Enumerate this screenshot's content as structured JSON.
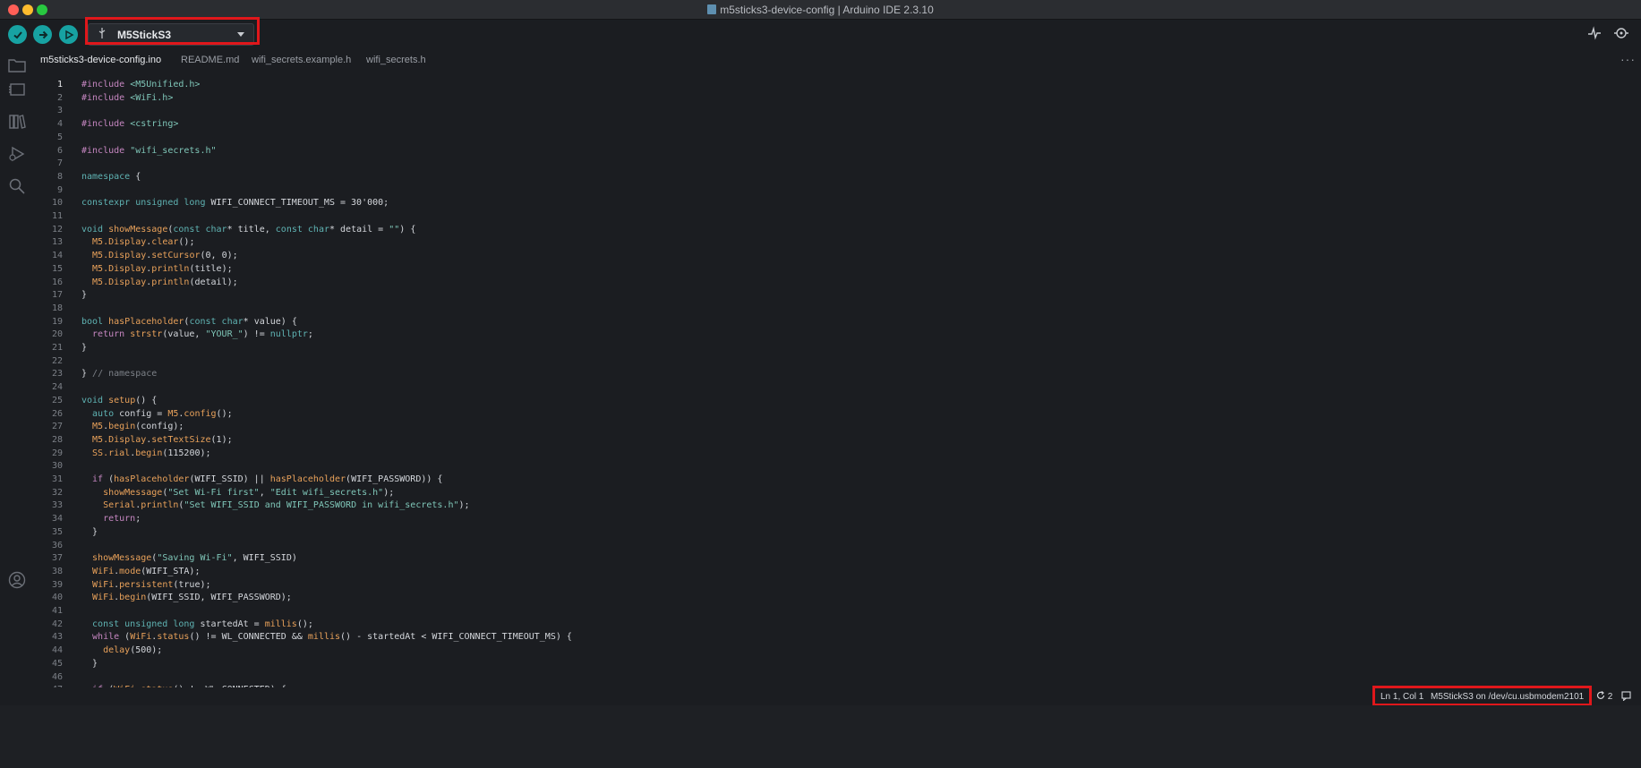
{
  "window": {
    "title": "m5sticks3-device-config | Arduino IDE 2.3.10"
  },
  "toolbar": {
    "verify_icon": "check-icon",
    "upload_icon": "arrow-right-icon",
    "debug_icon": "debug-icon",
    "board_name": "M5StickS3",
    "serial_plotter_icon": "plotter-icon",
    "serial_monitor_icon": "monitor-icon"
  },
  "sidebar": {
    "items": [
      {
        "icon": "folder-icon"
      },
      {
        "icon": "board-manager-icon"
      },
      {
        "icon": "library-icon"
      },
      {
        "icon": "debug-run-icon"
      },
      {
        "icon": "search-icon"
      },
      {
        "icon": "account-icon"
      }
    ]
  },
  "tabs": [
    {
      "label": "m5sticks3-device-config.ino"
    },
    {
      "label": "README.md"
    },
    {
      "label": "wifi_secrets.example.h"
    },
    {
      "label": "wifi_secrets.h"
    }
  ],
  "tabs_more": "···",
  "code_lines": [
    [
      {
        "t": "#include ",
        "c": "#c586c0"
      },
      {
        "t": "<M5Unified.h>",
        "c": "#7fc6b8"
      }
    ],
    [
      {
        "t": "#include ",
        "c": "#c586c0"
      },
      {
        "t": "<WiFi.h>",
        "c": "#7fc6b8"
      }
    ],
    [],
    [
      {
        "t": "#include ",
        "c": "#c586c0"
      },
      {
        "t": "<cstring>",
        "c": "#7fc6b8"
      }
    ],
    [],
    [
      {
        "t": "#include ",
        "c": "#c586c0"
      },
      {
        "t": "\"wifi_secrets.h\"",
        "c": "#7fc6b8"
      }
    ],
    [],
    [
      {
        "t": "namespace",
        "c": "#5fb3b3"
      },
      {
        "t": " {",
        "c": "#d4d7dc"
      }
    ],
    [],
    [
      {
        "t": "constexpr unsigned long ",
        "c": "#5fb3b3"
      },
      {
        "t": "WIFI_CONNECT_TIMEOUT_MS = 30'000;",
        "c": "#d4d7dc"
      }
    ],
    [],
    [
      {
        "t": "void ",
        "c": "#5fb3b3"
      },
      {
        "t": "showMessage",
        "c": "#e8a15a"
      },
      {
        "t": "(",
        "c": "#d4d7dc"
      },
      {
        "t": "const char",
        "c": "#5fb3b3"
      },
      {
        "t": "* title, ",
        "c": "#d4d7dc"
      },
      {
        "t": "const char",
        "c": "#5fb3b3"
      },
      {
        "t": "* detail = ",
        "c": "#d4d7dc"
      },
      {
        "t": "\"\"",
        "c": "#7fc6b8"
      },
      {
        "t": ") {",
        "c": "#d4d7dc"
      }
    ],
    [
      {
        "t": "  M5.",
        "c": "#e8a15a"
      },
      {
        "t": "Display",
        "c": "#e8a15a"
      },
      {
        "t": ".",
        "c": "#d4d7dc"
      },
      {
        "t": "clear",
        "c": "#e8a15a"
      },
      {
        "t": "();",
        "c": "#d4d7dc"
      }
    ],
    [
      {
        "t": "  M5.",
        "c": "#e8a15a"
      },
      {
        "t": "Display",
        "c": "#e8a15a"
      },
      {
        "t": ".",
        "c": "#d4d7dc"
      },
      {
        "t": "setCursor",
        "c": "#e8a15a"
      },
      {
        "t": "(0, 0);",
        "c": "#d4d7dc"
      }
    ],
    [
      {
        "t": "  M5.",
        "c": "#e8a15a"
      },
      {
        "t": "Display",
        "c": "#e8a15a"
      },
      {
        "t": ".",
        "c": "#d4d7dc"
      },
      {
        "t": "println",
        "c": "#e8a15a"
      },
      {
        "t": "(title);",
        "c": "#d4d7dc"
      }
    ],
    [
      {
        "t": "  M5.",
        "c": "#e8a15a"
      },
      {
        "t": "Display",
        "c": "#e8a15a"
      },
      {
        "t": ".",
        "c": "#d4d7dc"
      },
      {
        "t": "println",
        "c": "#e8a15a"
      },
      {
        "t": "(detail);",
        "c": "#d4d7dc"
      }
    ],
    [
      {
        "t": "}",
        "c": "#d4d7dc"
      }
    ],
    [],
    [
      {
        "t": "bool ",
        "c": "#5fb3b3"
      },
      {
        "t": "hasPlaceholder",
        "c": "#e8a15a"
      },
      {
        "t": "(",
        "c": "#d4d7dc"
      },
      {
        "t": "const char",
        "c": "#5fb3b3"
      },
      {
        "t": "* value) {",
        "c": "#d4d7dc"
      }
    ],
    [
      {
        "t": "  return ",
        "c": "#c586c0"
      },
      {
        "t": "strstr",
        "c": "#e8a15a"
      },
      {
        "t": "(value, ",
        "c": "#d4d7dc"
      },
      {
        "t": "\"YOUR_\"",
        "c": "#7fc6b8"
      },
      {
        "t": ") != ",
        "c": "#d4d7dc"
      },
      {
        "t": "nullptr",
        "c": "#5fb3b3"
      },
      {
        "t": ";",
        "c": "#d4d7dc"
      }
    ],
    [
      {
        "t": "}",
        "c": "#d4d7dc"
      }
    ],
    [],
    [
      {
        "t": "} ",
        "c": "#d4d7dc"
      },
      {
        "t": "// namespace",
        "c": "#7c8087"
      }
    ],
    [],
    [
      {
        "t": "void ",
        "c": "#5fb3b3"
      },
      {
        "t": "setup",
        "c": "#e8a15a"
      },
      {
        "t": "() {",
        "c": "#d4d7dc"
      }
    ],
    [
      {
        "t": "  auto ",
        "c": "#5fb3b3"
      },
      {
        "t": "config = ",
        "c": "#d4d7dc"
      },
      {
        "t": "M5",
        "c": "#e8a15a"
      },
      {
        "t": ".",
        "c": "#d4d7dc"
      },
      {
        "t": "config",
        "c": "#e8a15a"
      },
      {
        "t": "();",
        "c": "#d4d7dc"
      }
    ],
    [
      {
        "t": "  M5",
        "c": "#e8a15a"
      },
      {
        "t": ".",
        "c": "#d4d7dc"
      },
      {
        "t": "begin",
        "c": "#e8a15a"
      },
      {
        "t": "(config);",
        "c": "#d4d7dc"
      }
    ],
    [
      {
        "t": "  M5.",
        "c": "#e8a15a"
      },
      {
        "t": "Display",
        "c": "#e8a15a"
      },
      {
        "t": ".",
        "c": "#d4d7dc"
      },
      {
        "t": "setTextSize",
        "c": "#e8a15a"
      },
      {
        "t": "(1);",
        "c": "#d4d7dc"
      }
    ],
    [
      {
        "t": "  SS.",
        "c": "#e8a15a"
      },
      {
        "t": "rial",
        "c": "#e8a15a"
      },
      {
        "t": ".",
        "c": "#d4d7dc"
      },
      {
        "t": "begin",
        "c": "#e8a15a"
      },
      {
        "t": "(115200);",
        "c": "#d4d7dc"
      }
    ],
    [],
    [
      {
        "t": "  if ",
        "c": "#c586c0"
      },
      {
        "t": "(",
        "c": "#d4d7dc"
      },
      {
        "t": "hasPlaceholder",
        "c": "#e8a15a"
      },
      {
        "t": "(WIFI_SSID) || ",
        "c": "#d4d7dc"
      },
      {
        "t": "hasPlaceholder",
        "c": "#e8a15a"
      },
      {
        "t": "(WIFI_PASSWORD)) {",
        "c": "#d4d7dc"
      }
    ],
    [
      {
        "t": "    showMessage",
        "c": "#e8a15a"
      },
      {
        "t": "(",
        "c": "#d4d7dc"
      },
      {
        "t": "\"Set Wi-Fi first\"",
        "c": "#7fc6b8"
      },
      {
        "t": ", ",
        "c": "#d4d7dc"
      },
      {
        "t": "\"Edit wifi_secrets.h\"",
        "c": "#7fc6b8"
      },
      {
        "t": ");",
        "c": "#d4d7dc"
      }
    ],
    [
      {
        "t": "    Serial",
        "c": "#e8a15a"
      },
      {
        "t": ".",
        "c": "#d4d7dc"
      },
      {
        "t": "println",
        "c": "#e8a15a"
      },
      {
        "t": "(",
        "c": "#d4d7dc"
      },
      {
        "t": "\"Set WIFI_SSID and WIFI_PASSWORD in wifi_secrets.h\"",
        "c": "#7fc6b8"
      },
      {
        "t": ");",
        "c": "#d4d7dc"
      }
    ],
    [
      {
        "t": "    return",
        "c": "#c586c0"
      },
      {
        "t": ";",
        "c": "#d4d7dc"
      }
    ],
    [
      {
        "t": "  }",
        "c": "#d4d7dc"
      }
    ],
    [],
    [
      {
        "t": "  showMessage",
        "c": "#e8a15a"
      },
      {
        "t": "(",
        "c": "#d4d7dc"
      },
      {
        "t": "\"Saving Wi-Fi\"",
        "c": "#7fc6b8"
      },
      {
        "t": ", WIFI_SSID)",
        "c": "#d4d7dc"
      }
    ],
    [
      {
        "t": "  WiFi",
        "c": "#e8a15a"
      },
      {
        "t": ".",
        "c": "#d4d7dc"
      },
      {
        "t": "mode",
        "c": "#e8a15a"
      },
      {
        "t": "(WIFI_STA);",
        "c": "#d4d7dc"
      }
    ],
    [
      {
        "t": "  WiFi",
        "c": "#e8a15a"
      },
      {
        "t": ".",
        "c": "#d4d7dc"
      },
      {
        "t": "persistent",
        "c": "#e8a15a"
      },
      {
        "t": "(true);",
        "c": "#d4d7dc"
      }
    ],
    [
      {
        "t": "  WiFi",
        "c": "#e8a15a"
      },
      {
        "t": ".",
        "c": "#d4d7dc"
      },
      {
        "t": "begin",
        "c": "#e8a15a"
      },
      {
        "t": "(WIFI_SSID, WIFI_PASSWORD);",
        "c": "#d4d7dc"
      }
    ],
    [],
    [
      {
        "t": "  const unsigned long ",
        "c": "#5fb3b3"
      },
      {
        "t": "startedAt = ",
        "c": "#d4d7dc"
      },
      {
        "t": "millis",
        "c": "#e8a15a"
      },
      {
        "t": "();",
        "c": "#d4d7dc"
      }
    ],
    [
      {
        "t": "  while ",
        "c": "#c586c0"
      },
      {
        "t": "(",
        "c": "#d4d7dc"
      },
      {
        "t": "WiFi",
        "c": "#e8a15a"
      },
      {
        "t": ".",
        "c": "#d4d7dc"
      },
      {
        "t": "status",
        "c": "#e8a15a"
      },
      {
        "t": "() != WL_CONNECTED && ",
        "c": "#d4d7dc"
      },
      {
        "t": "millis",
        "c": "#e8a15a"
      },
      {
        "t": "() - startedAt < WIFI_CONNECT_TIMEOUT_MS) {",
        "c": "#d4d7dc"
      }
    ],
    [
      {
        "t": "    delay",
        "c": "#e8a15a"
      },
      {
        "t": "(500);",
        "c": "#d4d7dc"
      }
    ],
    [
      {
        "t": "  }",
        "c": "#d4d7dc"
      }
    ],
    [],
    [
      {
        "t": "  if ",
        "c": "#c586c0"
      },
      {
        "t": "(",
        "c": "#d4d7dc"
      },
      {
        "t": "WiFi",
        "c": "#e8a15a"
      },
      {
        "t": ".",
        "c": "#d4d7dc"
      },
      {
        "t": "status",
        "c": "#e8a15a"
      },
      {
        "t": "() != WL_CONNECTED) {",
        "c": "#d4d7dc"
      }
    ]
  ],
  "status": {
    "cursor": "Ln 1, Col 1",
    "board_port": "M5StickS3 on /dev/cu.usbmodem2101",
    "notifications_count": "2"
  },
  "colors": {
    "accent": "#17a2a2",
    "highlight": "#e0171b",
    "background": "#1b1d21"
  }
}
